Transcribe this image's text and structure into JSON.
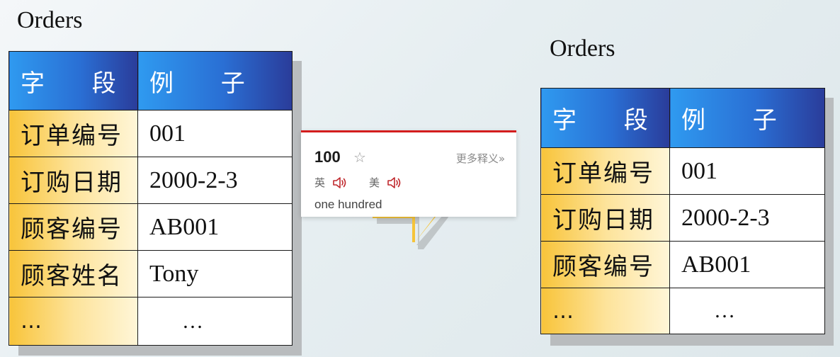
{
  "left": {
    "title": "Orders",
    "header": [
      "字 段",
      "例 子"
    ],
    "rows": [
      [
        "订单编号",
        "001"
      ],
      [
        "订购日期",
        "2000-2-3"
      ],
      [
        "顾客编号",
        "AB001"
      ],
      [
        "顾客姓名",
        "Tony"
      ],
      [
        "…",
        "…"
      ]
    ]
  },
  "right": {
    "title": "Orders",
    "header": [
      "字 段",
      "例 子"
    ],
    "rows": [
      [
        "订单编号",
        "001"
      ],
      [
        "订购日期",
        "2000-2-3"
      ],
      [
        "顾客编号",
        "AB001"
      ],
      [
        "…",
        "…"
      ]
    ]
  },
  "popup": {
    "word": "100",
    "star_icon": "star-outline-icon",
    "more_label": "更多释义»",
    "pron_uk_label": "英",
    "pron_us_label": "美",
    "speaker_icon": "speaker-icon",
    "definition": "one hundred",
    "accent_color": "#d41d1d"
  },
  "colors": {
    "header_start": "#2f9af0",
    "header_end": "#2a3c9a",
    "field_start": "#f8c43a",
    "field_end": "#fff6d8",
    "arrow": "#f5c43a"
  }
}
